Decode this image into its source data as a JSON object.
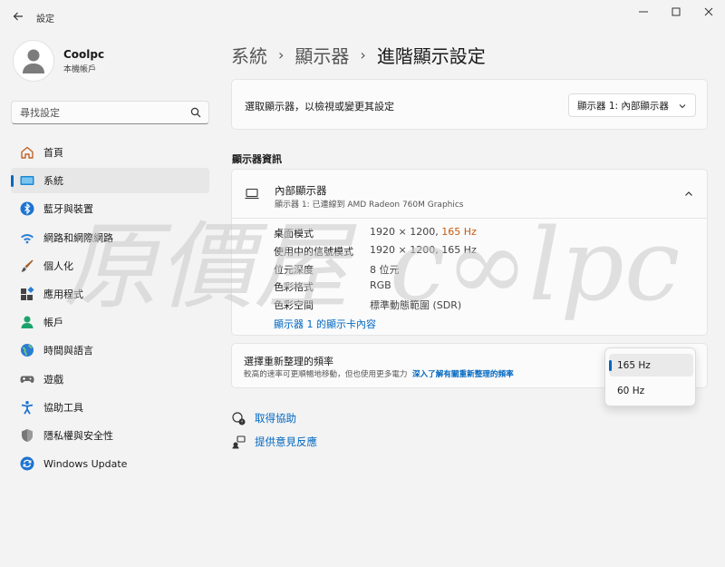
{
  "window": {
    "title": "設定"
  },
  "profile": {
    "name": "Coolpc",
    "account_type": "本機帳戶"
  },
  "search": {
    "placeholder": "尋找設定"
  },
  "sidebar": {
    "items": [
      {
        "label": "首頁",
        "icon": "home-icon"
      },
      {
        "label": "系統",
        "icon": "system-icon",
        "active": true
      },
      {
        "label": "藍牙與裝置",
        "icon": "bluetooth-icon"
      },
      {
        "label": "網路和網際網路",
        "icon": "wifi-icon"
      },
      {
        "label": "個人化",
        "icon": "brush-icon"
      },
      {
        "label": "應用程式",
        "icon": "apps-icon"
      },
      {
        "label": "帳戶",
        "icon": "account-icon"
      },
      {
        "label": "時間與語言",
        "icon": "globe-icon"
      },
      {
        "label": "遊戲",
        "icon": "gamepad-icon"
      },
      {
        "label": "協助工具",
        "icon": "accessibility-icon"
      },
      {
        "label": "隱私權與安全性",
        "icon": "shield-icon"
      },
      {
        "label": "Windows Update",
        "icon": "update-icon"
      }
    ]
  },
  "breadcrumb": {
    "items": [
      "系統",
      "顯示器"
    ],
    "current": "進階顯示設定"
  },
  "display_select": {
    "label": "選取顯示器，以檢視或變更其設定",
    "selected": "顯示器 1: 內部顯示器"
  },
  "display_info": {
    "section_title": "顯示器資訊",
    "name": "內部顯示器",
    "connection": "顯示器 1: 已連線到 AMD Radeon 760M Graphics",
    "specs": [
      {
        "key": "桌面模式",
        "value": "1920 × 1200, ",
        "highlight": "165 Hz"
      },
      {
        "key": "使用中的信號模式",
        "value": "1920 × 1200, 165 Hz"
      },
      {
        "key": "位元深度",
        "value": "8 位元"
      },
      {
        "key": "色彩格式",
        "value": "RGB"
      },
      {
        "key": "色彩空間",
        "value": "標準動態範圍 (SDR)"
      }
    ],
    "adapter_link": "顯示器 1 的顯示卡內容"
  },
  "refresh_rate": {
    "title": "選擇重新整理的頻率",
    "description": "較高的速率可更順暢地移動，但也使用更多電力",
    "learn_more": "深入了解有關重新整理的頻率",
    "options": [
      "165 Hz",
      "60 Hz"
    ],
    "selected": "165 Hz"
  },
  "help": {
    "get_help": "取得協助",
    "give_feedback": "提供意見反應"
  },
  "watermark": {
    "text_cn": "原價屋",
    "text_en": "c∞lpc"
  },
  "colors": {
    "accent": "#0067c0",
    "background": "#f3f3f3",
    "card": "#fbfbfb"
  }
}
